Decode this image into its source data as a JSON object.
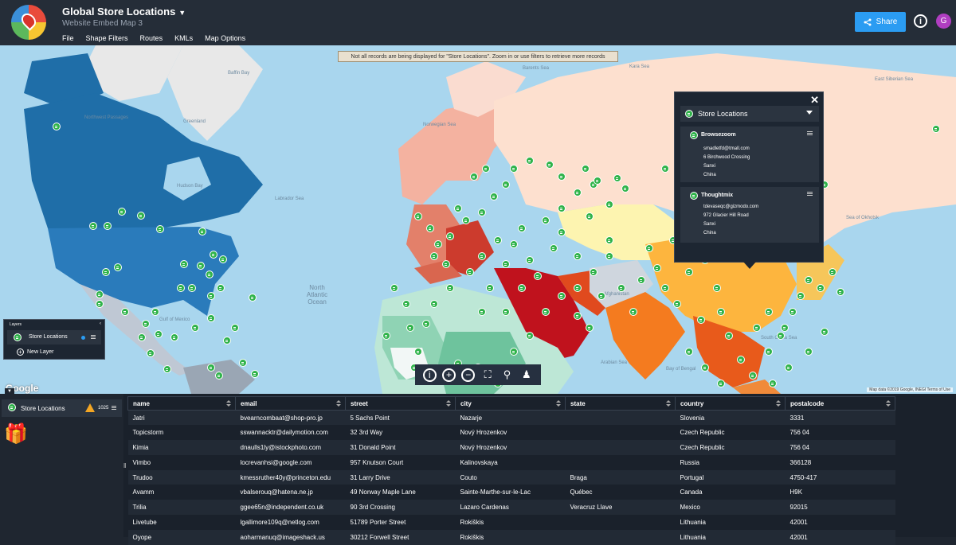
{
  "app": {
    "title": "Global Store Locations",
    "subtitle": "Website Embed Map 3",
    "menu": [
      "File",
      "Shape Filters",
      "Routes",
      "KMLs",
      "Map Options"
    ],
    "share_label": "Share",
    "info_label": "i",
    "avatar_initial": "G"
  },
  "map": {
    "notice": "Not all records are being displayed for \"Store Locations\". Zoom in or use filters to retrieve more records",
    "google_label": "Google",
    "attribution": "Map data ©2019 Google, INEGI   Terms of Use",
    "sea_labels": {
      "baffin_bay": "Baffin Bay",
      "hudson_bay": "Hudson Bay",
      "labrador_sea": "Labrador Sea",
      "norwegian_sea": "Norwegian Sea",
      "barents_sea": "Barents Sea",
      "kara_sea": "Kara Sea",
      "east_siberian_sea": "East Siberian Sea",
      "sea_of_okhotsk": "Sea of Okhotsk",
      "arabian_sea": "Arabian Sea",
      "bay_of_bengal": "Bay of Bengal",
      "south_china_sea": "South China Sea",
      "gulf_of_mexico": "Gulf of Mexico",
      "north_atlantic_ocean": "North Atlantic Ocean",
      "greenland": "Greenland",
      "afghanistan": "Afghanistan",
      "northwest_passages": "Northwest Passages"
    },
    "colors": {
      "water": "#a9d6ee",
      "usa_canada": "#2a7bbb",
      "mena": "#c0121d",
      "china": "#fdb53e",
      "russia": "#fde0cf",
      "pin": "#2fb34a"
    }
  },
  "popup": {
    "layer_name": "Store Locations",
    "records": [
      {
        "name": "Browsezoom",
        "email": "smadletfd@tmall.com",
        "street": "6 Birchwood Crossing",
        "city": "Sanxi",
        "country": "China"
      },
      {
        "name": "Thoughtmix",
        "email": "tdevaseqc@gizmodo.com",
        "street": "972 Glacier Hill Road",
        "city": "Sanxi",
        "country": "China"
      }
    ]
  },
  "layers_panel": {
    "header": "Layers",
    "layer_name": "Store Locations",
    "new_layer": "New Layer"
  },
  "data_panel": {
    "layer_name": "Store Locations",
    "record_count": "1025",
    "columns": [
      "name",
      "email",
      "street",
      "city",
      "state",
      "country",
      "postalcode"
    ],
    "rows": [
      [
        "Jatri",
        "bvearncombaat@shop-pro.jp",
        "5 Sachs Point",
        "Nazarje",
        "",
        "Slovenia",
        "3331"
      ],
      [
        "Topicstorm",
        "sswannacktr@dailymotion.com",
        "32 3rd Way",
        "Nový Hrozenkov",
        "",
        "Czech Republic",
        "756 04"
      ],
      [
        "Kimia",
        "dnaulls1ly@istockphoto.com",
        "31 Donald Point",
        "Nový Hrozenkov",
        "",
        "Czech Republic",
        "756 04"
      ],
      [
        "Vimbo",
        "locrevanhsi@google.com",
        "957 Knutson Court",
        "Kalinovskaya",
        "",
        "Russia",
        "366128"
      ],
      [
        "Trudoo",
        "kmessruther40y@princeton.edu",
        "31 Larry Drive",
        "Couto",
        "Braga",
        "Portugal",
        "4750-417"
      ],
      [
        "Avamm",
        "vbalserouq@hatena.ne.jp",
        "49 Norway Maple Lane",
        "Sainte-Marthe-sur-le-Lac",
        "Québec",
        "Canada",
        "H9K"
      ],
      [
        "Trilia",
        "ggee65n@independent.co.uk",
        "90 3rd Crossing",
        "Lazaro Cardenas",
        "Veracruz Llave",
        "Mexico",
        "92015"
      ],
      [
        "Livetube",
        "lgallimore109q@netlog.com",
        "51789 Porter Street",
        "Rokiškis",
        "",
        "Lithuania",
        "42001"
      ],
      [
        "Oyope",
        "aoharmanuq@imageshack.us",
        "30212 Forwell Street",
        "Rokiškis",
        "",
        "Lithuania",
        "42001"
      ]
    ]
  }
}
